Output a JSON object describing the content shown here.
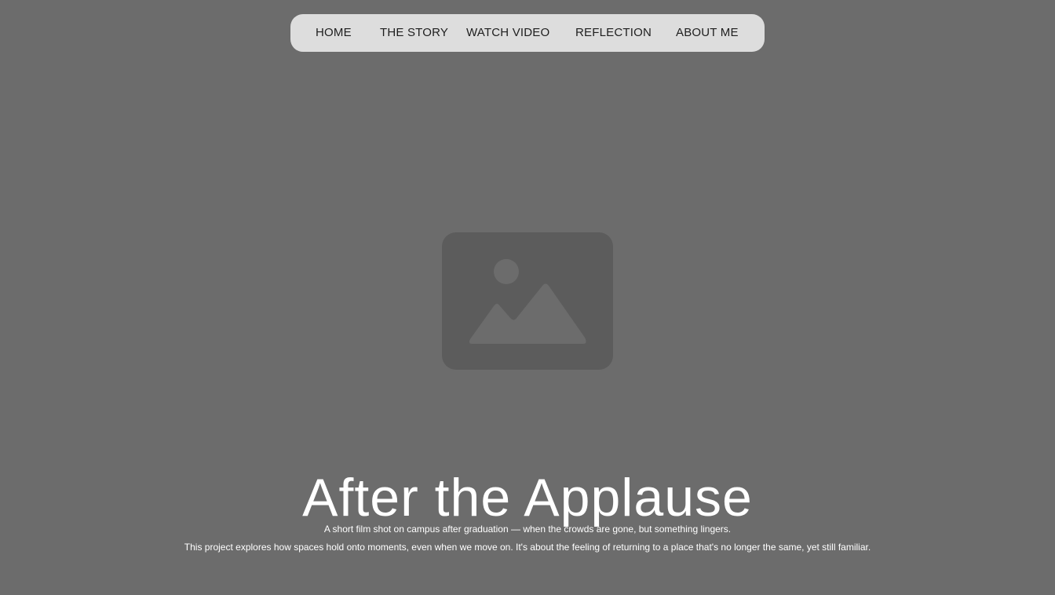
{
  "nav": {
    "items": [
      {
        "label": "HOME"
      },
      {
        "label": "THE STORY"
      },
      {
        "label": "WATCH VIDEO"
      },
      {
        "label": "REFLECTION"
      },
      {
        "label": "ABOUT ME"
      }
    ]
  },
  "hero": {
    "image_icon": "image-placeholder-icon",
    "title": "After the Applause",
    "description_line1": "A short film shot on campus after graduation — when the crowds are gone, but something lingers.",
    "description_line2": "This project explores how spaces hold onto moments, even when we move on. It's about the feeling of returning to a place that's no longer the same, yet still familiar."
  },
  "colors": {
    "background": "#6c6c6c",
    "nav_background": "#dddddd",
    "nav_text": "#1e1e1e",
    "image_placeholder": "#5c5c5c",
    "image_glyph": "#6c6c6c",
    "text": "#ffffff"
  }
}
